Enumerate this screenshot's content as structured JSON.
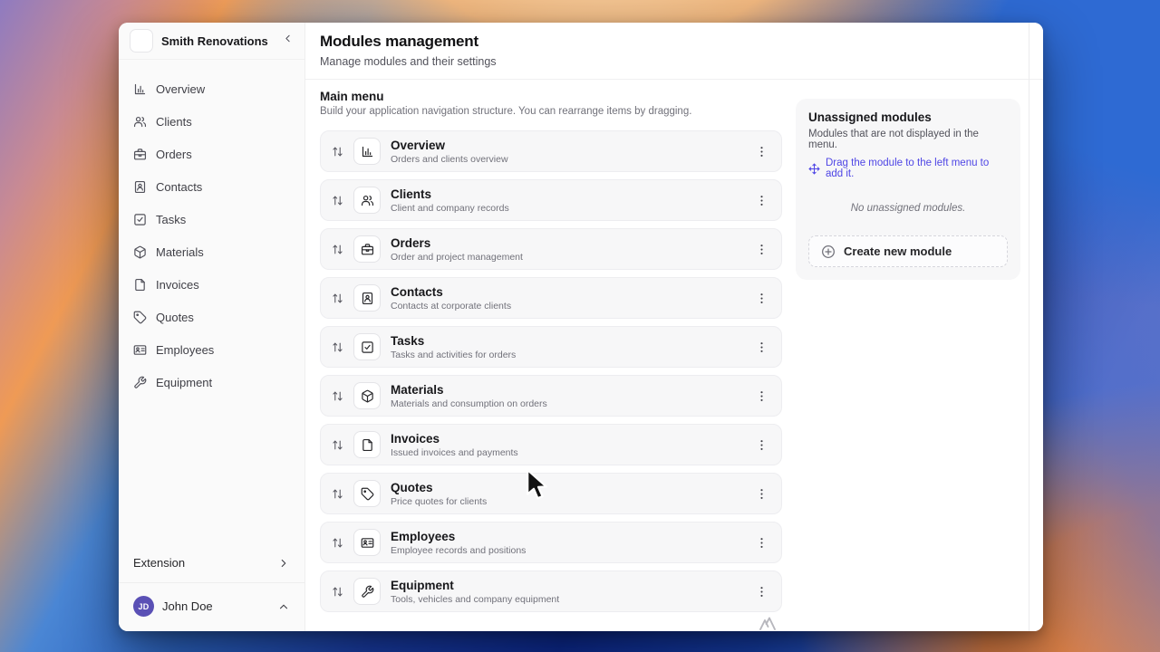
{
  "app": {
    "name": "Smith Renovations",
    "logo_icon": "briefcase"
  },
  "sidebar": {
    "items": [
      {
        "label": "Overview",
        "icon": "bar-chart"
      },
      {
        "label": "Clients",
        "icon": "users"
      },
      {
        "label": "Orders",
        "icon": "briefcase"
      },
      {
        "label": "Contacts",
        "icon": "contact-book"
      },
      {
        "label": "Tasks",
        "icon": "check-square"
      },
      {
        "label": "Materials",
        "icon": "package"
      },
      {
        "label": "Invoices",
        "icon": "file"
      },
      {
        "label": "Quotes",
        "icon": "tag"
      },
      {
        "label": "Employees",
        "icon": "id-card"
      },
      {
        "label": "Equipment",
        "icon": "wrench"
      }
    ],
    "extension_label": "Extension",
    "user": {
      "initials": "JD",
      "name": "John Doe"
    }
  },
  "header": {
    "title": "Modules management",
    "subtitle": "Manage modules and their settings"
  },
  "main_menu": {
    "title": "Main menu",
    "caption": "Build your application navigation structure. You can rearrange items by dragging."
  },
  "modules": [
    {
      "title": "Overview",
      "description": "Orders and clients overview",
      "icon": "bar-chart"
    },
    {
      "title": "Clients",
      "description": "Client and company records",
      "icon": "users"
    },
    {
      "title": "Orders",
      "description": "Order and project management",
      "icon": "briefcase"
    },
    {
      "title": "Contacts",
      "description": "Contacts at corporate clients",
      "icon": "contact-book"
    },
    {
      "title": "Tasks",
      "description": "Tasks and activities for orders",
      "icon": "check-square"
    },
    {
      "title": "Materials",
      "description": "Materials and consumption on orders",
      "icon": "package"
    },
    {
      "title": "Invoices",
      "description": "Issued invoices and payments",
      "icon": "file"
    },
    {
      "title": "Quotes",
      "description": "Price quotes for clients",
      "icon": "tag"
    },
    {
      "title": "Employees",
      "description": "Employee records and positions",
      "icon": "id-card"
    },
    {
      "title": "Equipment",
      "description": "Tools, vehicles and company equipment",
      "icon": "wrench"
    }
  ],
  "unassigned_panel": {
    "title": "Unassigned modules",
    "subtitle": "Modules that are not displayed in the menu.",
    "drag_hint": "Drag the module to the left menu to add it.",
    "drag_hint_icon": "move",
    "empty_text": "No unassigned modules.",
    "create_button_label": "Create new module",
    "create_button_icon": "plus-circle"
  },
  "colors": {
    "accent_indigo": "#4f46e5",
    "avatar_purple": "#5a50b5"
  }
}
